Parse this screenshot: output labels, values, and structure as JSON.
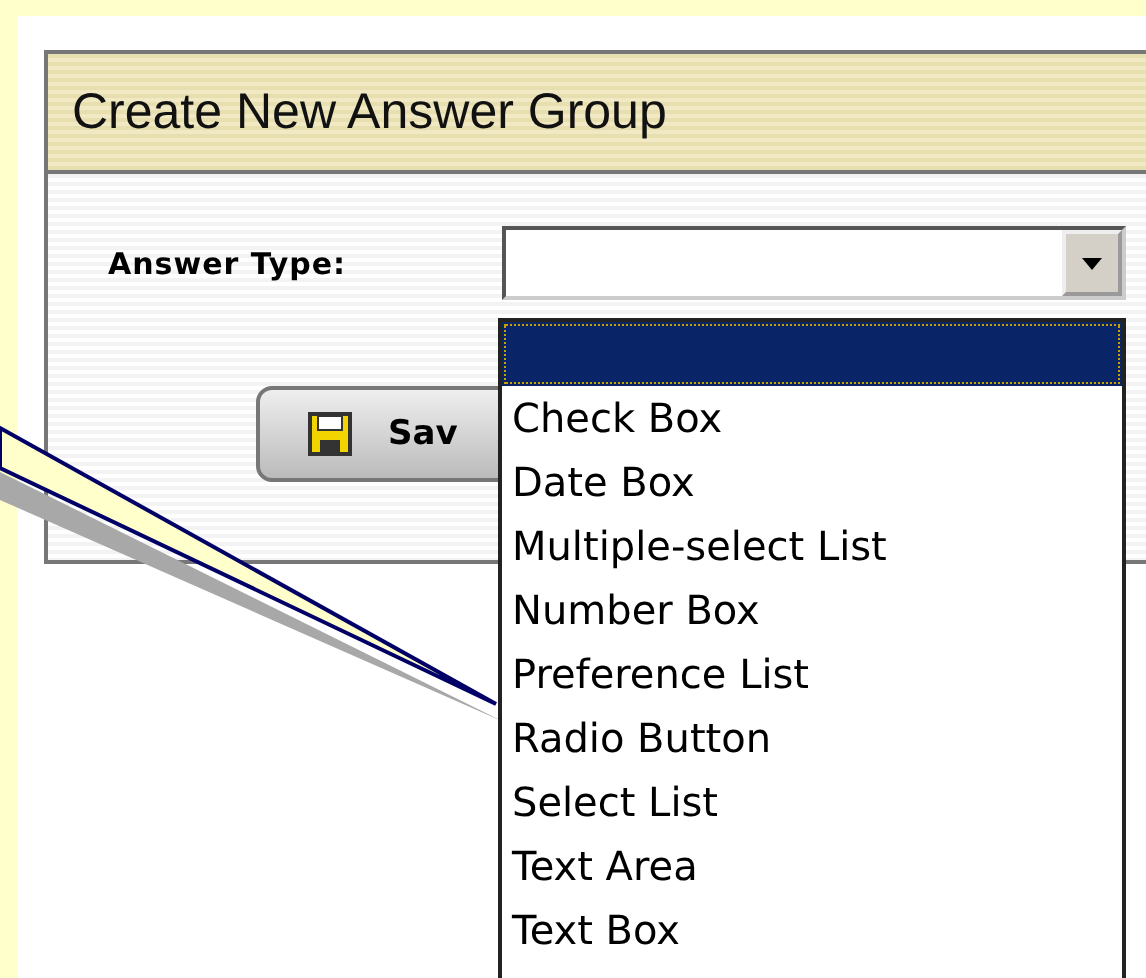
{
  "panel": {
    "title": "Create New Answer Group"
  },
  "form": {
    "label": "Answer Type:"
  },
  "save_button": {
    "label": "Sav"
  },
  "dropdown": {
    "options": [
      {
        "selected": true
      },
      {
        "label": "Check Box",
        "selected": false
      },
      {
        "label": "Date Box",
        "selected": false
      },
      {
        "label": "Multiple-select List",
        "selected": false
      },
      {
        "label": "Number Box",
        "selected": false
      },
      {
        "label": "Preference List",
        "selected": false
      },
      {
        "label": "Radio Button",
        "selected": false
      },
      {
        "label": "Select List",
        "selected": false
      },
      {
        "label": "Text Area",
        "selected": false
      },
      {
        "label": "Text Box",
        "selected": false
      }
    ]
  }
}
